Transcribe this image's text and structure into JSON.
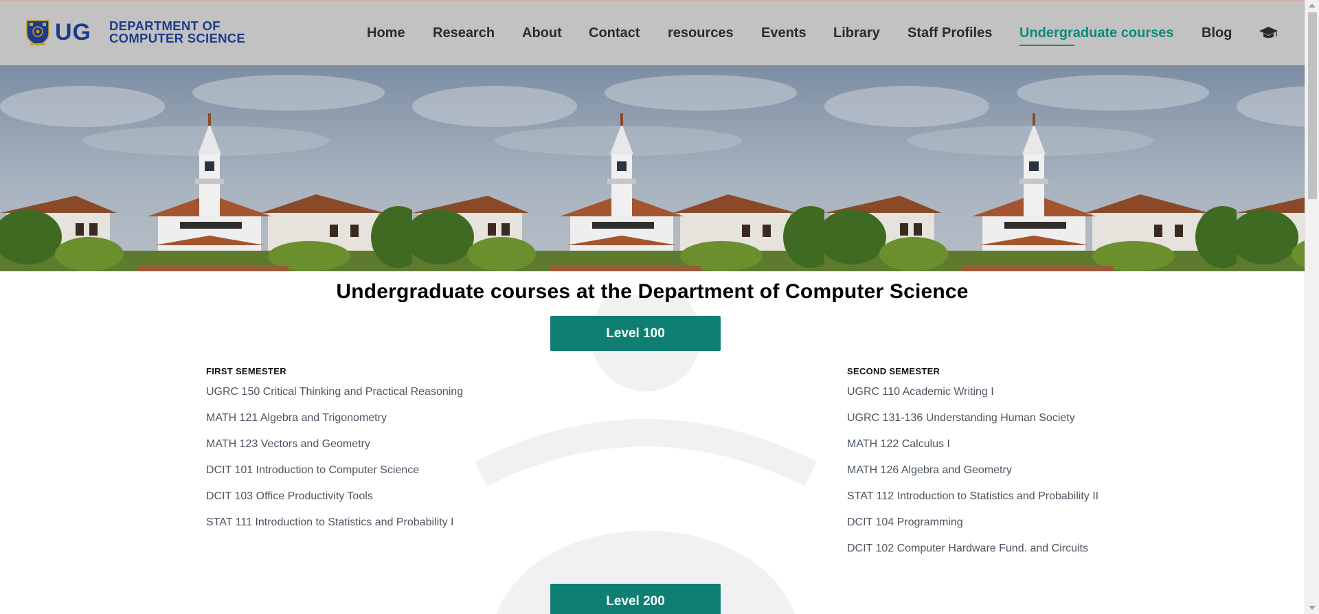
{
  "brand": {
    "abbr": "UG",
    "dept_line1": "DEPARTMENT OF",
    "dept_line2": "COMPUTER SCIENCE",
    "color": "#1d3b8a"
  },
  "nav": {
    "items": [
      {
        "label": "Home"
      },
      {
        "label": "Research"
      },
      {
        "label": "About"
      },
      {
        "label": "Contact"
      },
      {
        "label": "resources"
      },
      {
        "label": "Events"
      },
      {
        "label": "Library"
      },
      {
        "label": "Staff Profiles"
      },
      {
        "label": "Undergraduate courses",
        "active": true
      },
      {
        "label": "Blog"
      }
    ],
    "extra_icon": "graduation-cap-icon",
    "active_color": "#0b8a7c"
  },
  "hero": {
    "image": "university-clock-tower-banner"
  },
  "main": {
    "title": "Undergraduate courses at the Department of Computer Science",
    "accent_color": "#0f7f73",
    "levels": [
      {
        "label": "Level 100",
        "first_semester": {
          "heading": "FIRST SEMESTER",
          "courses": [
            "UGRC 150 Critical Thinking and Practical Reasoning",
            "MATH 121 Algebra and Trigonometry",
            "MATH 123 Vectors and Geometry",
            "DCIT 101 Introduction to Computer Science",
            "DCIT 103 Office Productivity Tools",
            "STAT 111 Introduction to Statistics and Probability I"
          ]
        },
        "second_semester": {
          "heading": "SECOND SEMESTER",
          "courses": [
            "UGRC 110 Academic Writing I",
            "UGRC 131-136 Understanding Human Society",
            "MATH 122 Calculus I",
            "MATH 126 Algebra and Geometry",
            "STAT 112 Introduction to Statistics and Probability II",
            "DCIT 104 Programming",
            "DCIT 102 Computer Hardware Fund. and Circuits"
          ]
        }
      },
      {
        "label": "Level 200"
      }
    ]
  }
}
